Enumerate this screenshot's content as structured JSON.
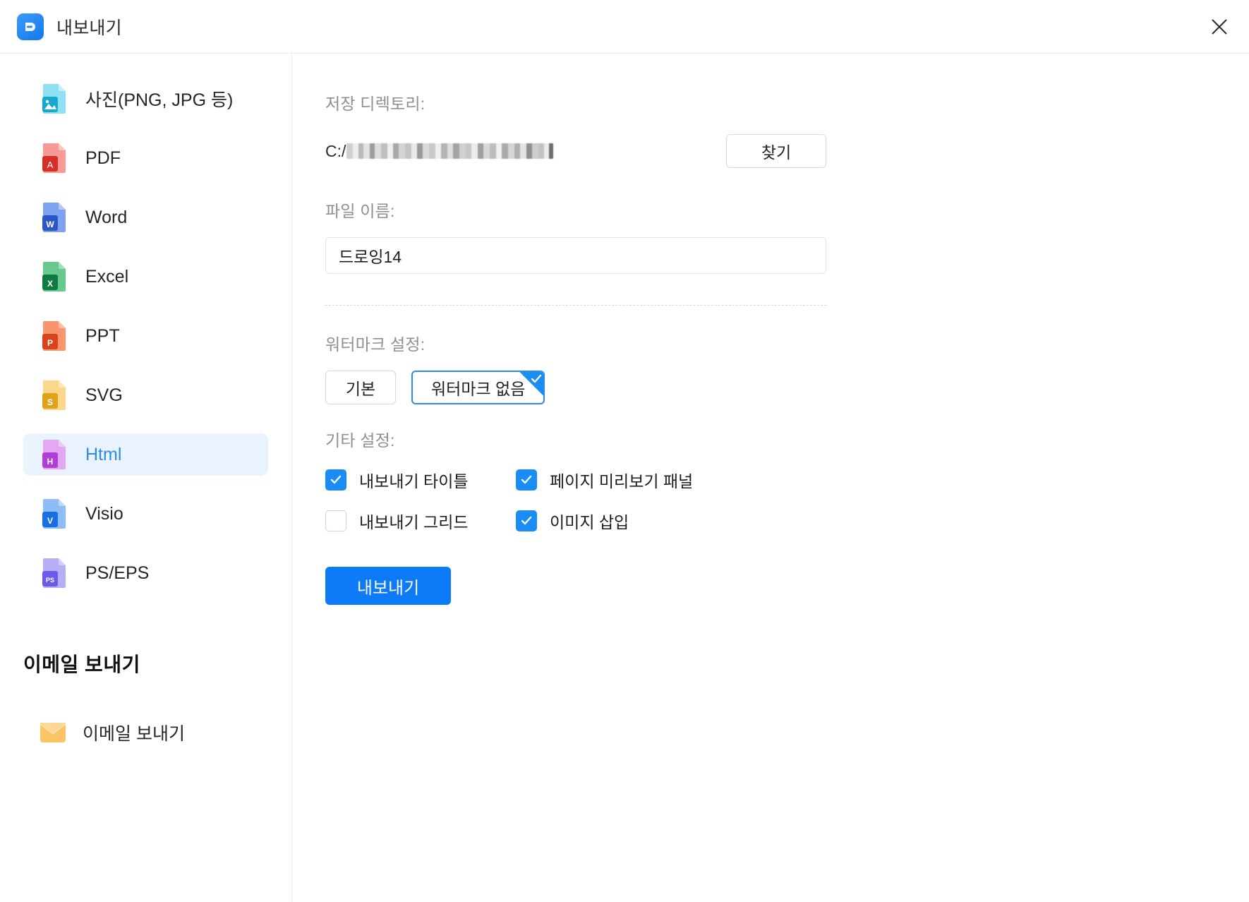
{
  "window": {
    "title": "내보내기",
    "logo_icon": "edrawmax-logo-icon",
    "close_icon": "close-icon"
  },
  "sidebar": {
    "items": [
      {
        "label": "사진(PNG, JPG 등)",
        "icon": "image-file-icon",
        "badge": "",
        "selected": false,
        "color": "#15a9cf",
        "color_light": "#8fe0f2"
      },
      {
        "label": "PDF",
        "icon": "pdf-file-icon",
        "badge": "A",
        "selected": false,
        "color": "#d62f2a",
        "color_light": "#f79a93"
      },
      {
        "label": "Word",
        "icon": "word-file-icon",
        "badge": "W",
        "selected": false,
        "color": "#2a57c4",
        "color_light": "#7fa2ee"
      },
      {
        "label": "Excel",
        "icon": "excel-file-icon",
        "badge": "X",
        "selected": false,
        "color": "#10793f",
        "color_light": "#66c98d"
      },
      {
        "label": "PPT",
        "icon": "ppt-file-icon",
        "badge": "P",
        "selected": false,
        "color": "#d8421c",
        "color_light": "#f8956e"
      },
      {
        "label": "SVG",
        "icon": "svg-file-icon",
        "badge": "S",
        "selected": false,
        "color": "#e0a21b",
        "color_light": "#fad78a"
      },
      {
        "label": "Html",
        "icon": "html-file-icon",
        "badge": "H",
        "selected": true,
        "color": "#b23fd4",
        "color_light": "#e4a7f4"
      },
      {
        "label": "Visio",
        "icon": "visio-file-icon",
        "badge": "V",
        "selected": false,
        "color": "#1a6fe0",
        "color_light": "#8dbcf6"
      },
      {
        "label": "PS/EPS",
        "icon": "ps-eps-file-icon",
        "badge": "PS",
        "selected": false,
        "color": "#6a5bea",
        "color_light": "#b6aef6"
      }
    ],
    "email_section_title": "이메일 보내기",
    "email_item": {
      "label": "이메일 보내기",
      "icon": "envelope-icon"
    }
  },
  "main": {
    "directory_label": "저장 디렉토리:",
    "directory_value_prefix": "C:/",
    "directory_value_redacted": true,
    "browse_button": "찾기",
    "filename_label": "파일 이름:",
    "filename_value": "드로잉14",
    "watermark_label": "워터마크 설정:",
    "watermark_options": [
      {
        "label": "기본",
        "selected": false
      },
      {
        "label": "워터마크 없음",
        "selected": true
      }
    ],
    "other_label": "기타 설정:",
    "checkboxes": [
      {
        "label": "내보내기 타이틀",
        "checked": true
      },
      {
        "label": "페이지 미리보기 패널",
        "checked": true
      },
      {
        "label": "내보내기 그리드",
        "checked": false
      },
      {
        "label": "이미지 삽입",
        "checked": true
      }
    ],
    "export_button": "내보내기"
  },
  "colors": {
    "accent": "#1a8cf5",
    "accent_button": "#0d7bf7",
    "selected_bg": "#e8f3fe",
    "selected_text": "#2b8cf0",
    "label_gray": "#8e8e93"
  }
}
